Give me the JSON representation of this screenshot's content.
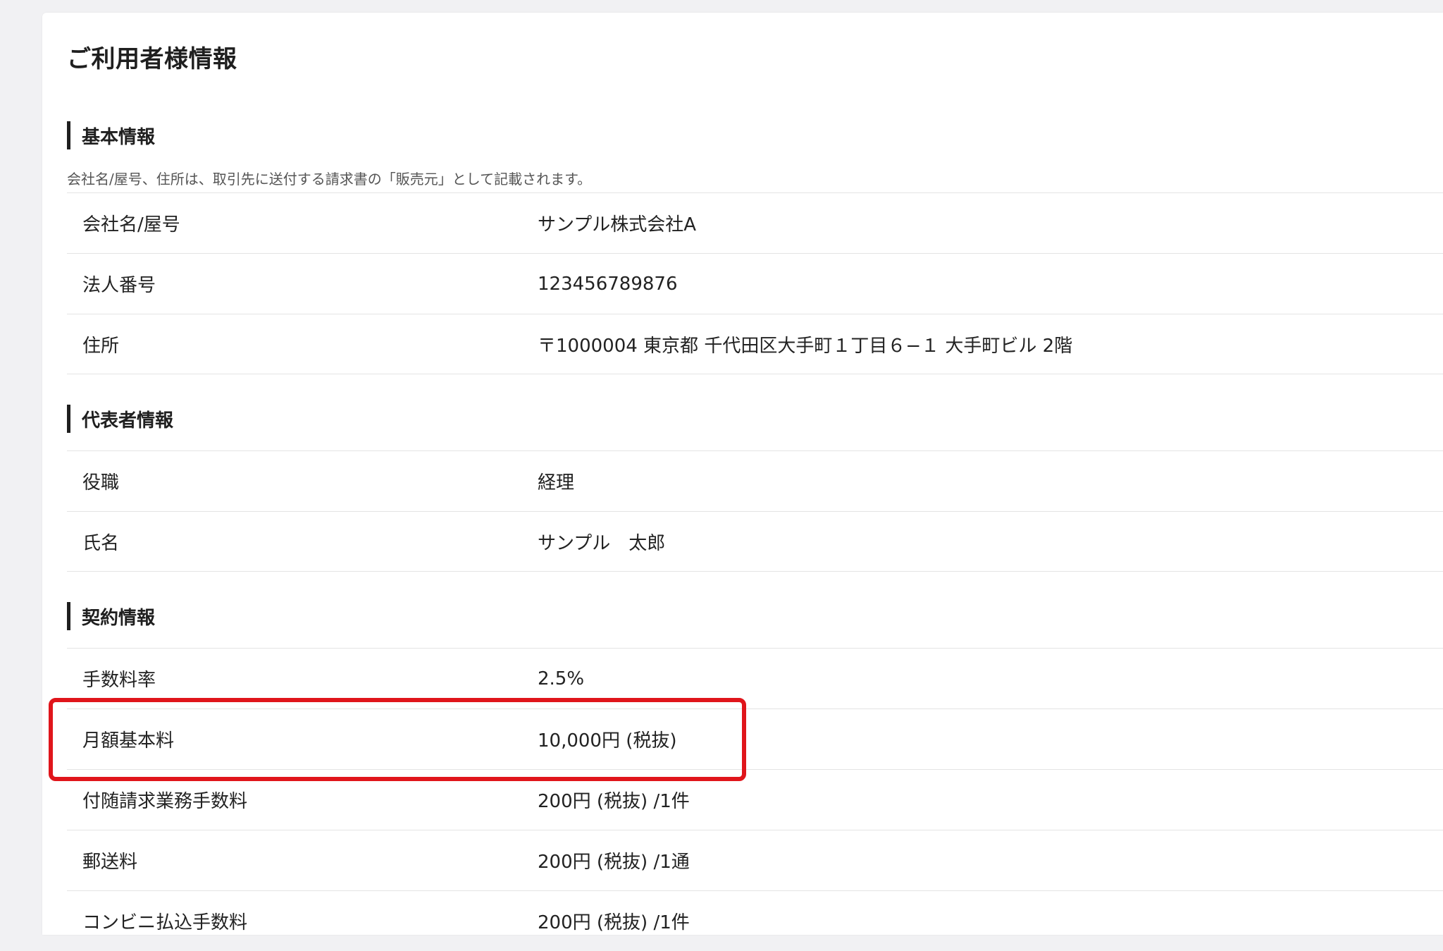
{
  "page_title": "ご利用者様情報",
  "highlight_color": "#e0151b",
  "sections": {
    "basic": {
      "title": "基本情報",
      "note": "会社名/屋号、住所は、取引先に送付する請求書の「販売元」として記載されます。",
      "rows": [
        {
          "label": "会社名/屋号",
          "value": "サンプル株式会社A"
        },
        {
          "label": "法人番号",
          "value": "123456789876"
        },
        {
          "label": "住所",
          "value": "〒1000004 東京都 千代田区大手町１丁目６−１ 大手町ビル 2階"
        }
      ]
    },
    "representative": {
      "title": "代表者情報",
      "rows": [
        {
          "label": "役職",
          "value": "経理"
        },
        {
          "label": "氏名",
          "value": "サンプル　太郎"
        }
      ]
    },
    "contract": {
      "title": "契約情報",
      "rows": [
        {
          "label": "手数料率",
          "value": "2.5%"
        },
        {
          "label": "月額基本料",
          "value": "10,000円 (税抜)"
        },
        {
          "label": "付随請求業務手数料",
          "value": "200円 (税抜) /1件"
        },
        {
          "label": "郵送料",
          "value": "200円 (税抜) /1通"
        },
        {
          "label": "コンビニ払込手数料",
          "value": "200円 (税抜) /1件"
        }
      ]
    }
  }
}
